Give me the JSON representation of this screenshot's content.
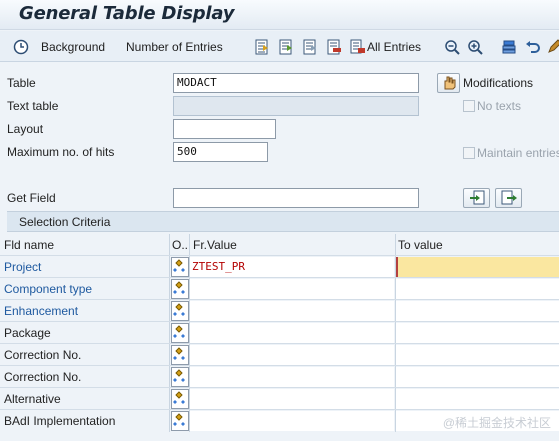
{
  "window": {
    "title": "General Table Display"
  },
  "toolbar": {
    "background": "Background",
    "number_of_entries": "Number of Entries",
    "all_entries": "All Entries"
  },
  "form": {
    "table_label": "Table",
    "table_value": "MODACT",
    "text_table_label": "Text table",
    "layout_label": "Layout",
    "max_hits_label": "Maximum no. of hits",
    "max_hits_value": "500",
    "get_field_label": "Get Field",
    "modifications_label": "Modifications",
    "no_texts_label": "No texts",
    "maintain_entries_label": "Maintain entries"
  },
  "selection": {
    "title": "Selection Criteria",
    "columns": {
      "fld_name": "Fld name",
      "op": "O..",
      "from": "Fr.Value",
      "to": "To value"
    },
    "rows": [
      {
        "name": "Project",
        "from": "ZTEST_PR",
        "to": ""
      },
      {
        "name": "Component type",
        "from": "",
        "to": ""
      },
      {
        "name": "Enhancement",
        "from": "",
        "to": ""
      },
      {
        "name": "Package",
        "from": "",
        "to": ""
      },
      {
        "name": "Correction No.",
        "from": "",
        "to": ""
      },
      {
        "name": "Correction No.",
        "from": "",
        "to": ""
      },
      {
        "name": "Alternative",
        "from": "",
        "to": ""
      },
      {
        "name": "BAdI Implementation",
        "from": "",
        "to": ""
      }
    ]
  },
  "watermark": "@稀土掘金技术社区",
  "colors": {
    "link": "#1f5aa0",
    "from_value": "#b30000",
    "focus_field": "#fae7a0"
  }
}
